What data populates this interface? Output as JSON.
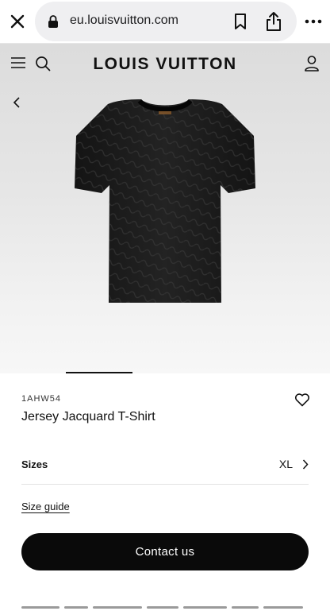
{
  "browser": {
    "url": "eu.louisvuitton.com"
  },
  "header": {
    "brand": "LOUIS VUITTON"
  },
  "product": {
    "sku": "1AHW54",
    "title": "Jersey Jacquard T-Shirt",
    "sizes_label": "Sizes",
    "selected_size": "XL",
    "size_guide_label": "Size guide",
    "contact_label": "Contact us"
  },
  "icons": {
    "close": "close-icon",
    "lock": "lock-icon",
    "bookmark": "bookmark-icon",
    "share": "share-icon",
    "more": "more-icon",
    "menu": "menu-icon",
    "search": "search-icon",
    "account": "account-icon",
    "back": "chevron-left-icon",
    "wishlist": "heart-icon",
    "sizes": "chevron-right-icon"
  },
  "colors": {
    "primary_button": "#0a0a0a",
    "url_bar": "#efeff1",
    "hero_background": "#e6e6e6"
  }
}
